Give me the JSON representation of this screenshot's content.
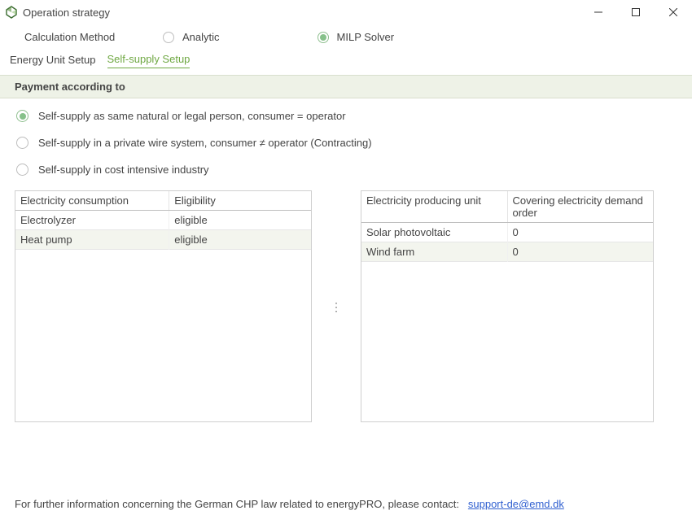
{
  "window": {
    "title": "Operation strategy"
  },
  "calc": {
    "label": "Calculation Method",
    "analytic": "Analytic",
    "milp": "MILP Solver",
    "selected": "milp"
  },
  "tabs": {
    "energy_unit": "Energy Unit Setup",
    "self_supply": "Self-supply Setup"
  },
  "section": {
    "header": "Payment according to"
  },
  "payment_options": [
    {
      "label": "Self-supply as same natural or legal person, consumer = operator",
      "selected": true
    },
    {
      "label": "Self-supply in a private wire system, consumer ≠ operator (Contracting)",
      "selected": false
    },
    {
      "label": "Self-supply in cost intensive industry",
      "selected": false
    }
  ],
  "left_table": {
    "headers": [
      "Electricity consumption",
      "Eligibility"
    ],
    "rows": [
      {
        "c0": "Electrolyzer",
        "c1": "eligible"
      },
      {
        "c0": "Heat pump",
        "c1": "eligible"
      }
    ]
  },
  "right_table": {
    "headers": [
      "Electricity producing unit",
      "Covering electricity demand order"
    ],
    "rows": [
      {
        "c0": "Solar photovoltaic",
        "c1": "0"
      },
      {
        "c0": "Wind farm",
        "c1": "0"
      }
    ]
  },
  "footer": {
    "text": "For further information concerning the German CHP law related to energyPRO, please contact:",
    "link_text": "support-de@emd.dk"
  }
}
